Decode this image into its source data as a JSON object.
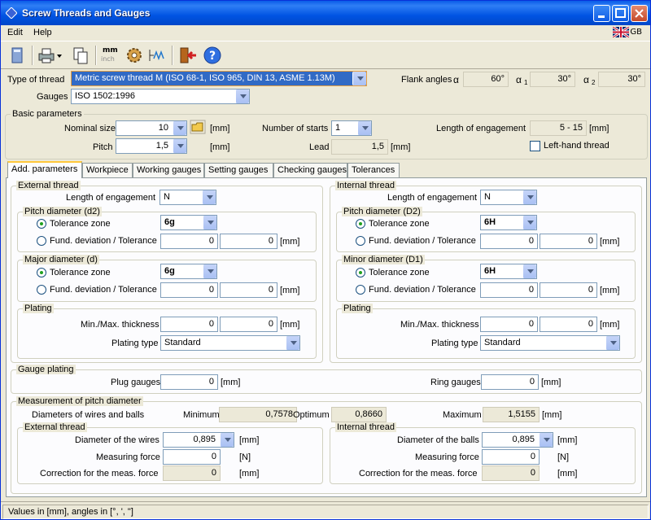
{
  "window": {
    "title": "Screw Threads and Gauges"
  },
  "menu": {
    "edit": "Edit",
    "help": "Help",
    "lang": "GB"
  },
  "toolbar": {
    "mm_label": "mm",
    "inch_label": "inch"
  },
  "header": {
    "type_label": "Type of thread",
    "type_value": "Metric screw thread M (ISO 68-1, ISO 965, DIN 13, ASME 1.13M)",
    "gauges_label": "Gauges",
    "gauges_value": "ISO 1502:1996",
    "flank_label": "Flank angles",
    "alpha": "α",
    "alpha1": "α",
    "alpha1_sub": "1",
    "alpha2": "α",
    "alpha2_sub": "2",
    "flank_a": "60°",
    "flank_a1": "30°",
    "flank_a2": "30°"
  },
  "basic": {
    "title": "Basic parameters",
    "nominal_label": "Nominal size",
    "nominal_value": "10",
    "nominal_unit": "[mm]",
    "pitch_label": "Pitch",
    "pitch_value": "1,5",
    "pitch_unit": "[mm]",
    "starts_label": "Number of starts",
    "starts_value": "1",
    "lead_label": "Lead",
    "lead_value": "1,5",
    "lead_unit": "[mm]",
    "engagement_label": "Length of engagement",
    "engagement_value": "5 - 15",
    "engagement_unit": "[mm]",
    "lefthand_label": "Left-hand thread"
  },
  "tabs": [
    "Add. parameters",
    "Workpiece",
    "Working gauges",
    "Setting gauges",
    "Checking gauges",
    "Tolerances"
  ],
  "external": {
    "title": "External thread",
    "eng_label": "Length of engagement",
    "eng_value": "N",
    "pitch_title": "Pitch diameter (d2)",
    "tz_label": "Tolerance zone",
    "tz_value": "6g",
    "fd_label": "Fund. deviation / Tolerance",
    "fd_a": "0",
    "fd_b": "0",
    "unit": "[mm]",
    "major_title": "Major diameter (d)",
    "tz2_value": "6g",
    "fd2_a": "0",
    "fd2_b": "0",
    "plating_title": "Plating",
    "thick_label": "Min./Max. thickness",
    "thick_a": "0",
    "thick_b": "0",
    "ptype_label": "Plating type",
    "ptype_value": "Standard"
  },
  "internal": {
    "title": "Internal thread",
    "eng_label": "Length of engagement",
    "eng_value": "N",
    "pitch_title": "Pitch diameter (D2)",
    "tz_label": "Tolerance zone",
    "tz_value": "6H",
    "fd_label": "Fund. deviation / Tolerance",
    "fd_a": "0",
    "fd_b": "0",
    "unit": "[mm]",
    "minor_title": "Minor diameter (D1)",
    "tz2_value": "6H",
    "fd2_a": "0",
    "fd2_b": "0",
    "plating_title": "Plating",
    "thick_label": "Min./Max. thickness",
    "thick_a": "0",
    "thick_b": "0",
    "ptype_label": "Plating type",
    "ptype_value": "Standard"
  },
  "gauge_plating": {
    "title": "Gauge plating",
    "plug_label": "Plug gauges",
    "plug_value": "0",
    "ring_label": "Ring gauges",
    "ring_value": "0",
    "unit": "[mm]"
  },
  "measurement": {
    "title": "Measurement of pitch diameter",
    "wires_label": "Diameters of wires and balls",
    "min_label": "Minimum",
    "min_value": "0,7578",
    "opt_label": "Optimum",
    "opt_value": "0,8660",
    "max_label": "Maximum",
    "max_value": "1,5155",
    "unit": "[mm]",
    "ext_title": "External thread",
    "ext_wire_label": "Diameter of the wires",
    "ext_wire_value": "0,895",
    "force_label": "Measuring force",
    "force_value": "0",
    "force_unit": "[N]",
    "corr_label": "Correction for the meas. force",
    "corr_value": "0",
    "int_title": "Internal thread",
    "int_ball_label": "Diameter of the balls",
    "int_ball_value": "0,895",
    "int_force_value": "0",
    "int_corr_value": "0"
  },
  "status": "Values in [mm], angles in [°, ', \"]"
}
